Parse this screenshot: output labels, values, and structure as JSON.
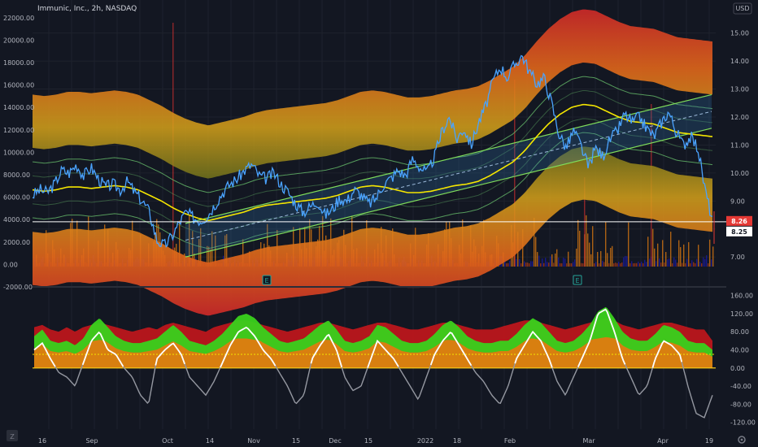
{
  "header": {
    "title": "Immunic, Inc., 2h, NASDAQ",
    "currency": "USD"
  },
  "colors": {
    "background": "#131722",
    "price_line": "#4aa3ff",
    "ema_line": "#f5e600",
    "band_red": "#c62828",
    "band_orange": "#f57c00",
    "band_yellow": "#d4a017",
    "channel_green": "#66bb6a",
    "volume_blue": "#1a1aa8",
    "osc_green": "#39d11c",
    "osc_red": "#c4161c",
    "osc_orange": "#e07b10",
    "osc_white": "#ffffff",
    "osc_gray": "#9598a1",
    "last_price_badge": "#e53935"
  },
  "chart_data": [
    {
      "type": "line",
      "title": "Immunic, Inc., 2h, NASDAQ",
      "right_axis": {
        "ticks": [
          "15.00",
          "14.00",
          "13.00",
          "12.00",
          "11.00",
          "10.00",
          "9.00",
          "8.00",
          "7.00"
        ],
        "ylim": [
          6.6,
          15.6
        ]
      },
      "left_axis": {
        "ticks": [
          "22000.00",
          "20000.00",
          "18000.00",
          "16000.00",
          "14000.00",
          "12000.00",
          "10000.00",
          "8000.00",
          "6000.00",
          "4000.00",
          "2000.00",
          "0.00",
          "-2000.00"
        ],
        "ylim": [
          -2000,
          23000
        ]
      },
      "last_price_labels": [
        "8.26",
        "8.25"
      ],
      "price_series": {
        "name": "",
        "values": [
          9.2,
          9.4,
          9.3,
          9.6,
          10.1,
          10.0,
          10.3,
          9.9,
          10.2,
          9.8,
          9.5,
          9.6,
          9.4,
          9.7,
          9.3,
          9.0,
          8.6,
          7.6,
          7.4,
          7.7,
          8.2,
          8.6,
          8.4,
          8.3,
          8.5,
          8.9,
          9.3,
          9.6,
          9.8,
          10.1,
          10.3,
          9.9,
          9.8,
          10.0,
          9.6,
          9.3,
          8.9,
          8.6,
          8.8,
          9.0,
          8.5,
          8.7,
          9.1,
          9.0,
          9.4,
          9.2,
          8.9,
          9.1,
          9.6,
          9.8,
          10.1,
          9.9,
          10.5,
          10.2,
          10.0,
          10.6,
          11.5,
          12.0,
          11.2,
          11.6,
          11.0,
          11.8,
          12.4,
          13.3,
          13.8,
          13.4,
          13.9,
          14.2,
          13.6,
          13.2,
          13.4,
          12.5,
          11.4,
          10.9,
          11.5,
          11.0,
          10.2,
          10.9,
          10.6,
          11.2,
          11.5,
          12.1,
          11.8,
          12.0,
          11.6,
          11.3,
          11.8,
          12.2,
          11.5,
          11.0,
          11.3,
          10.9,
          9.4,
          8.3
        ]
      },
      "ema_series": {
        "name": "",
        "values": [
          9.4,
          9.35,
          9.4,
          9.5,
          9.5,
          9.45,
          9.5,
          9.55,
          9.5,
          9.4,
          9.2,
          9.0,
          8.75,
          8.55,
          8.4,
          8.3,
          8.4,
          8.5,
          8.6,
          8.75,
          8.85,
          8.9,
          8.95,
          9.0,
          9.05,
          9.1,
          9.2,
          9.35,
          9.5,
          9.55,
          9.5,
          9.4,
          9.3,
          9.3,
          9.35,
          9.45,
          9.55,
          9.6,
          9.7,
          9.9,
          10.15,
          10.4,
          10.8,
          11.3,
          11.75,
          12.1,
          12.35,
          12.45,
          12.4,
          12.2,
          12.0,
          11.85,
          11.8,
          11.75,
          11.6,
          11.45,
          11.4,
          11.35,
          11.3
        ]
      },
      "x_tick_labels": [
        "16",
        "Sep",
        "Oct",
        "14",
        "Nov",
        "15",
        "Dec",
        "15",
        "2022",
        "18",
        "Feb",
        "Mar",
        "Apr",
        "19"
      ],
      "earnings_markers": [
        "E",
        "E"
      ]
    },
    {
      "type": "area",
      "title": "",
      "axis": {
        "ticks": [
          "160.00",
          "120.00",
          "80.00",
          "40.00",
          "0.00",
          "-40.00",
          "-80.00",
          "-120.00"
        ],
        "ylim": [
          -135,
          170
        ]
      },
      "reference_lines": [
        0,
        30
      ],
      "series_white": [
        40,
        55,
        20,
        -10,
        -20,
        -40,
        10,
        60,
        80,
        40,
        30,
        0,
        -20,
        -60,
        -80,
        20,
        40,
        55,
        30,
        -20,
        -40,
        -60,
        -30,
        10,
        50,
        80,
        90,
        70,
        40,
        20,
        -10,
        -40,
        -80,
        -60,
        20,
        50,
        75,
        40,
        -20,
        -50,
        -40,
        10,
        60,
        40,
        20,
        -10,
        -40,
        -70,
        -20,
        30,
        60,
        80,
        50,
        20,
        -10,
        -30,
        -60,
        -80,
        -40,
        20,
        50,
        80,
        60,
        20,
        -30,
        -60,
        -20,
        20,
        60,
        120,
        130,
        80,
        20,
        -20,
        -60,
        -40,
        20,
        60,
        50,
        30,
        -40,
        -100,
        -110,
        -60
      ],
      "series_green": [
        70,
        85,
        60,
        55,
        60,
        50,
        65,
        95,
        110,
        90,
        70,
        60,
        55,
        55,
        60,
        65,
        80,
        95,
        80,
        60,
        55,
        50,
        60,
        75,
        95,
        115,
        120,
        110,
        90,
        75,
        60,
        55,
        60,
        65,
        80,
        95,
        105,
        85,
        60,
        55,
        60,
        70,
        95,
        90,
        75,
        60,
        55,
        55,
        60,
        75,
        95,
        105,
        90,
        70,
        60,
        55,
        55,
        60,
        60,
        75,
        95,
        110,
        100,
        80,
        60,
        55,
        60,
        75,
        95,
        125,
        135,
        110,
        80,
        65,
        60,
        60,
        75,
        95,
        90,
        80,
        60,
        55,
        55,
        40
      ],
      "series_red": [
        90,
        95,
        85,
        80,
        90,
        80,
        90,
        95,
        100,
        95,
        90,
        85,
        80,
        85,
        90,
        85,
        95,
        100,
        95,
        90,
        85,
        80,
        90,
        95,
        100,
        105,
        105,
        100,
        95,
        90,
        85,
        80,
        85,
        90,
        95,
        100,
        100,
        95,
        90,
        85,
        90,
        95,
        100,
        100,
        95,
        90,
        85,
        85,
        90,
        95,
        100,
        100,
        95,
        90,
        85,
        85,
        85,
        90,
        95,
        100,
        105,
        105,
        100,
        95,
        90,
        85,
        90,
        95,
        100,
        105,
        110,
        105,
        95,
        90,
        85,
        90,
        95,
        100,
        100,
        95,
        90,
        85,
        85,
        60
      ]
    }
  ]
}
